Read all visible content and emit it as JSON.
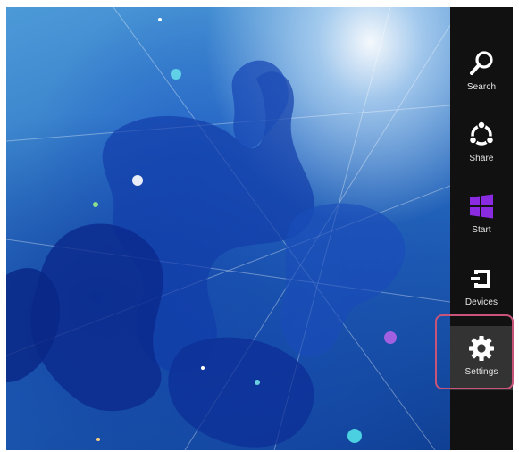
{
  "charms": {
    "search": {
      "label": "Search",
      "icon": "search-icon"
    },
    "share": {
      "label": "Share",
      "icon": "share-icon"
    },
    "start": {
      "label": "Start",
      "icon": "windows-logo-icon",
      "color": "#8a2be2"
    },
    "devices": {
      "label": "Devices",
      "icon": "devices-icon"
    },
    "settings": {
      "label": "Settings",
      "icon": "gear-icon",
      "selected": true
    }
  },
  "colors": {
    "charm_bar": "#111111",
    "selected_charm": "#333333",
    "highlight_border": "#c8547a",
    "wallpaper_blue": "#2f76c6"
  }
}
